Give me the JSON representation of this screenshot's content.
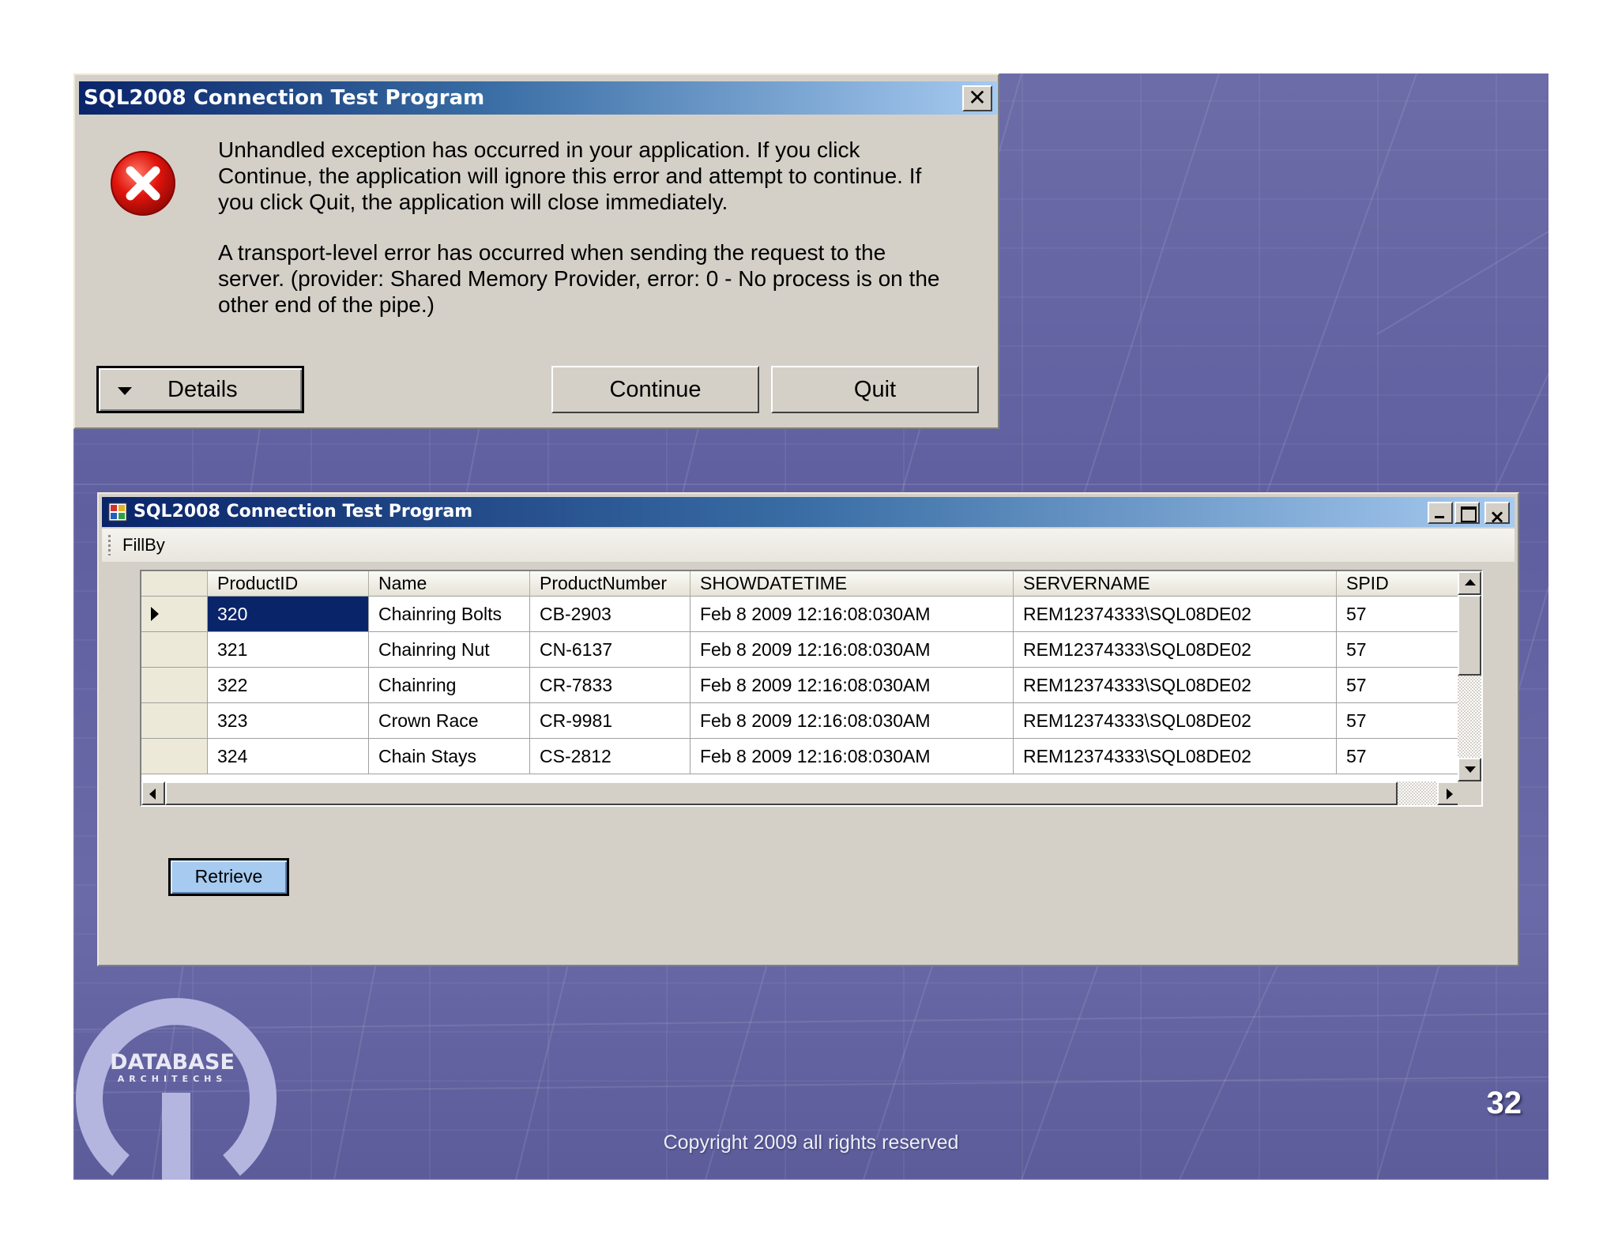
{
  "error_dialog": {
    "title": "SQL2008 Connection Test Program",
    "close_glyph": "✕",
    "message_1": "Unhandled exception has occurred in your application. If you click Continue, the application will ignore this error and attempt to continue. If you click Quit, the application will close immediately.",
    "message_2": "A transport-level error has occurred when sending the request to the server. (provider: Shared Memory Provider, error: 0 - No process is on the other end of the pipe.)",
    "details_label": "Details",
    "continue_label": "Continue",
    "quit_label": "Quit",
    "icon": "error-icon"
  },
  "app_window": {
    "title": "SQL2008 Connection Test Program",
    "menu": {
      "fillby_label": "FillBy"
    },
    "grid": {
      "columns": [
        "ProductID",
        "Name",
        "ProductNumber",
        "SHOWDATETIME",
        "SERVERNAME",
        "SPID"
      ],
      "rows": [
        [
          "320",
          "Chainring Bolts",
          "CB-2903",
          "Feb  8 2009 12:16:08:030AM",
          "REM12374333\\SQL08DE02",
          "57"
        ],
        [
          "321",
          "Chainring Nut",
          "CN-6137",
          "Feb  8 2009 12:16:08:030AM",
          "REM12374333\\SQL08DE02",
          "57"
        ],
        [
          "322",
          "Chainring",
          "CR-7833",
          "Feb  8 2009 12:16:08:030AM",
          "REM12374333\\SQL08DE02",
          "57"
        ],
        [
          "323",
          "Crown Race",
          "CR-9981",
          "Feb  8 2009 12:16:08:030AM",
          "REM12374333\\SQL08DE02",
          "57"
        ],
        [
          "324",
          "Chain Stays",
          "CS-2812",
          "Feb  8 2009 12:16:08:030AM",
          "REM12374333\\SQL08DE02",
          "57"
        ]
      ]
    },
    "retrieve_label": "Retrieve"
  },
  "slide": {
    "logo_text": "DATABASE",
    "logo_subtext": "ARCHITECHS",
    "copyright": "Copyright 2009 all rights reserved",
    "page_number": "32"
  },
  "colors": {
    "slide_bg": "#6666a6",
    "titlebar_start": "#0a246a",
    "titlebar_end": "#a6caf0",
    "window_face": "#d4d0c8",
    "selection": "#0a246a",
    "retrieve_button": "#a6caf0"
  }
}
